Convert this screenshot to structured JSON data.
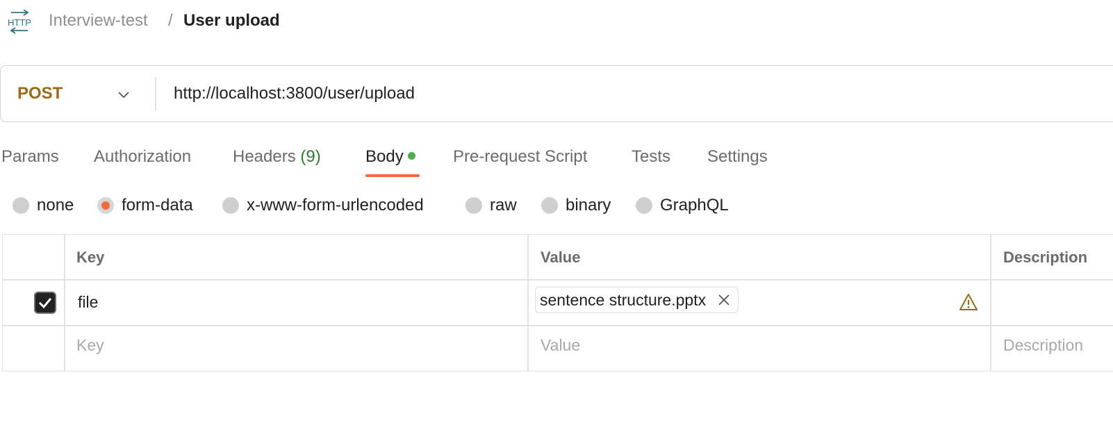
{
  "breadcrumb": {
    "icon": "http-icon",
    "parent": "Interview-test",
    "separator": "/",
    "current": "User upload"
  },
  "request": {
    "method": "POST",
    "url": "http://localhost:3800/user/upload"
  },
  "tabs": [
    {
      "label": "Params"
    },
    {
      "label": "Authorization"
    },
    {
      "label": "Headers",
      "count": "(9)"
    },
    {
      "label": "Body",
      "active": true,
      "indicator": "green-dot"
    },
    {
      "label": "Pre-request Script"
    },
    {
      "label": "Tests"
    },
    {
      "label": "Settings"
    }
  ],
  "body_types": {
    "options": [
      "none",
      "form-data",
      "x-www-form-urlencoded",
      "raw",
      "binary",
      "GraphQL"
    ],
    "selected": "form-data"
  },
  "form_table": {
    "headers": {
      "key": "Key",
      "value": "Value",
      "description": "Description"
    },
    "rows": [
      {
        "checked": true,
        "key": "file",
        "value_file": "sentence structure.pptx",
        "warning": true,
        "description": ""
      }
    ],
    "placeholders": {
      "key": "Key",
      "value": "Value",
      "description": "Description"
    }
  },
  "colors": {
    "accent": "#f26b3a",
    "method": "#9a6b16",
    "active_dot": "#4caf50",
    "headers_count": "#2e7d32",
    "warning": "#9a6b16"
  }
}
